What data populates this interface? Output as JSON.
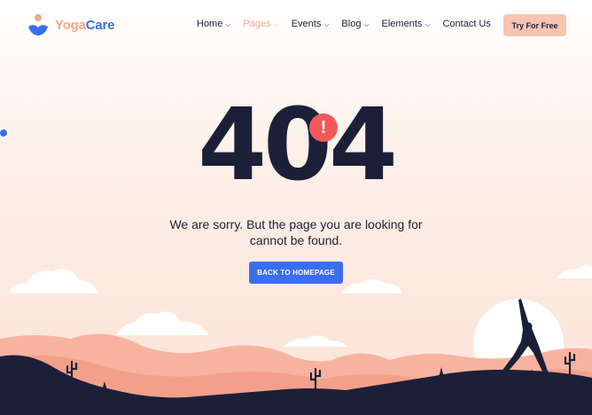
{
  "brand": {
    "name_part1": "Yoga",
    "name_part2": "Care",
    "primary": "#3c6df0",
    "accent": "#f7a58c",
    "dark": "#1b2038"
  },
  "nav": {
    "items": [
      {
        "label": "Home",
        "chevron": true,
        "active": false
      },
      {
        "label": "Pages",
        "chevron": true,
        "active": true
      },
      {
        "label": "Events",
        "chevron": true,
        "active": false
      },
      {
        "label": "Blog",
        "chevron": true,
        "active": false
      },
      {
        "label": "Elements",
        "chevron": true,
        "active": false
      },
      {
        "label": "Contact Us",
        "chevron": false,
        "active": false
      }
    ],
    "cta_label": "Try For Free"
  },
  "error": {
    "code": "404",
    "alert_mark": "!",
    "message": "We are sorry. But the page you are looking for cannot be found.",
    "button_label": "BACK TO HOMEPAGE"
  },
  "icons": [
    "yoga-logo-icon",
    "chevron-down-icon",
    "alert-icon",
    "cactus-icon",
    "yoga-silhouette-icon",
    "cloud-icon",
    "sun-icon"
  ]
}
